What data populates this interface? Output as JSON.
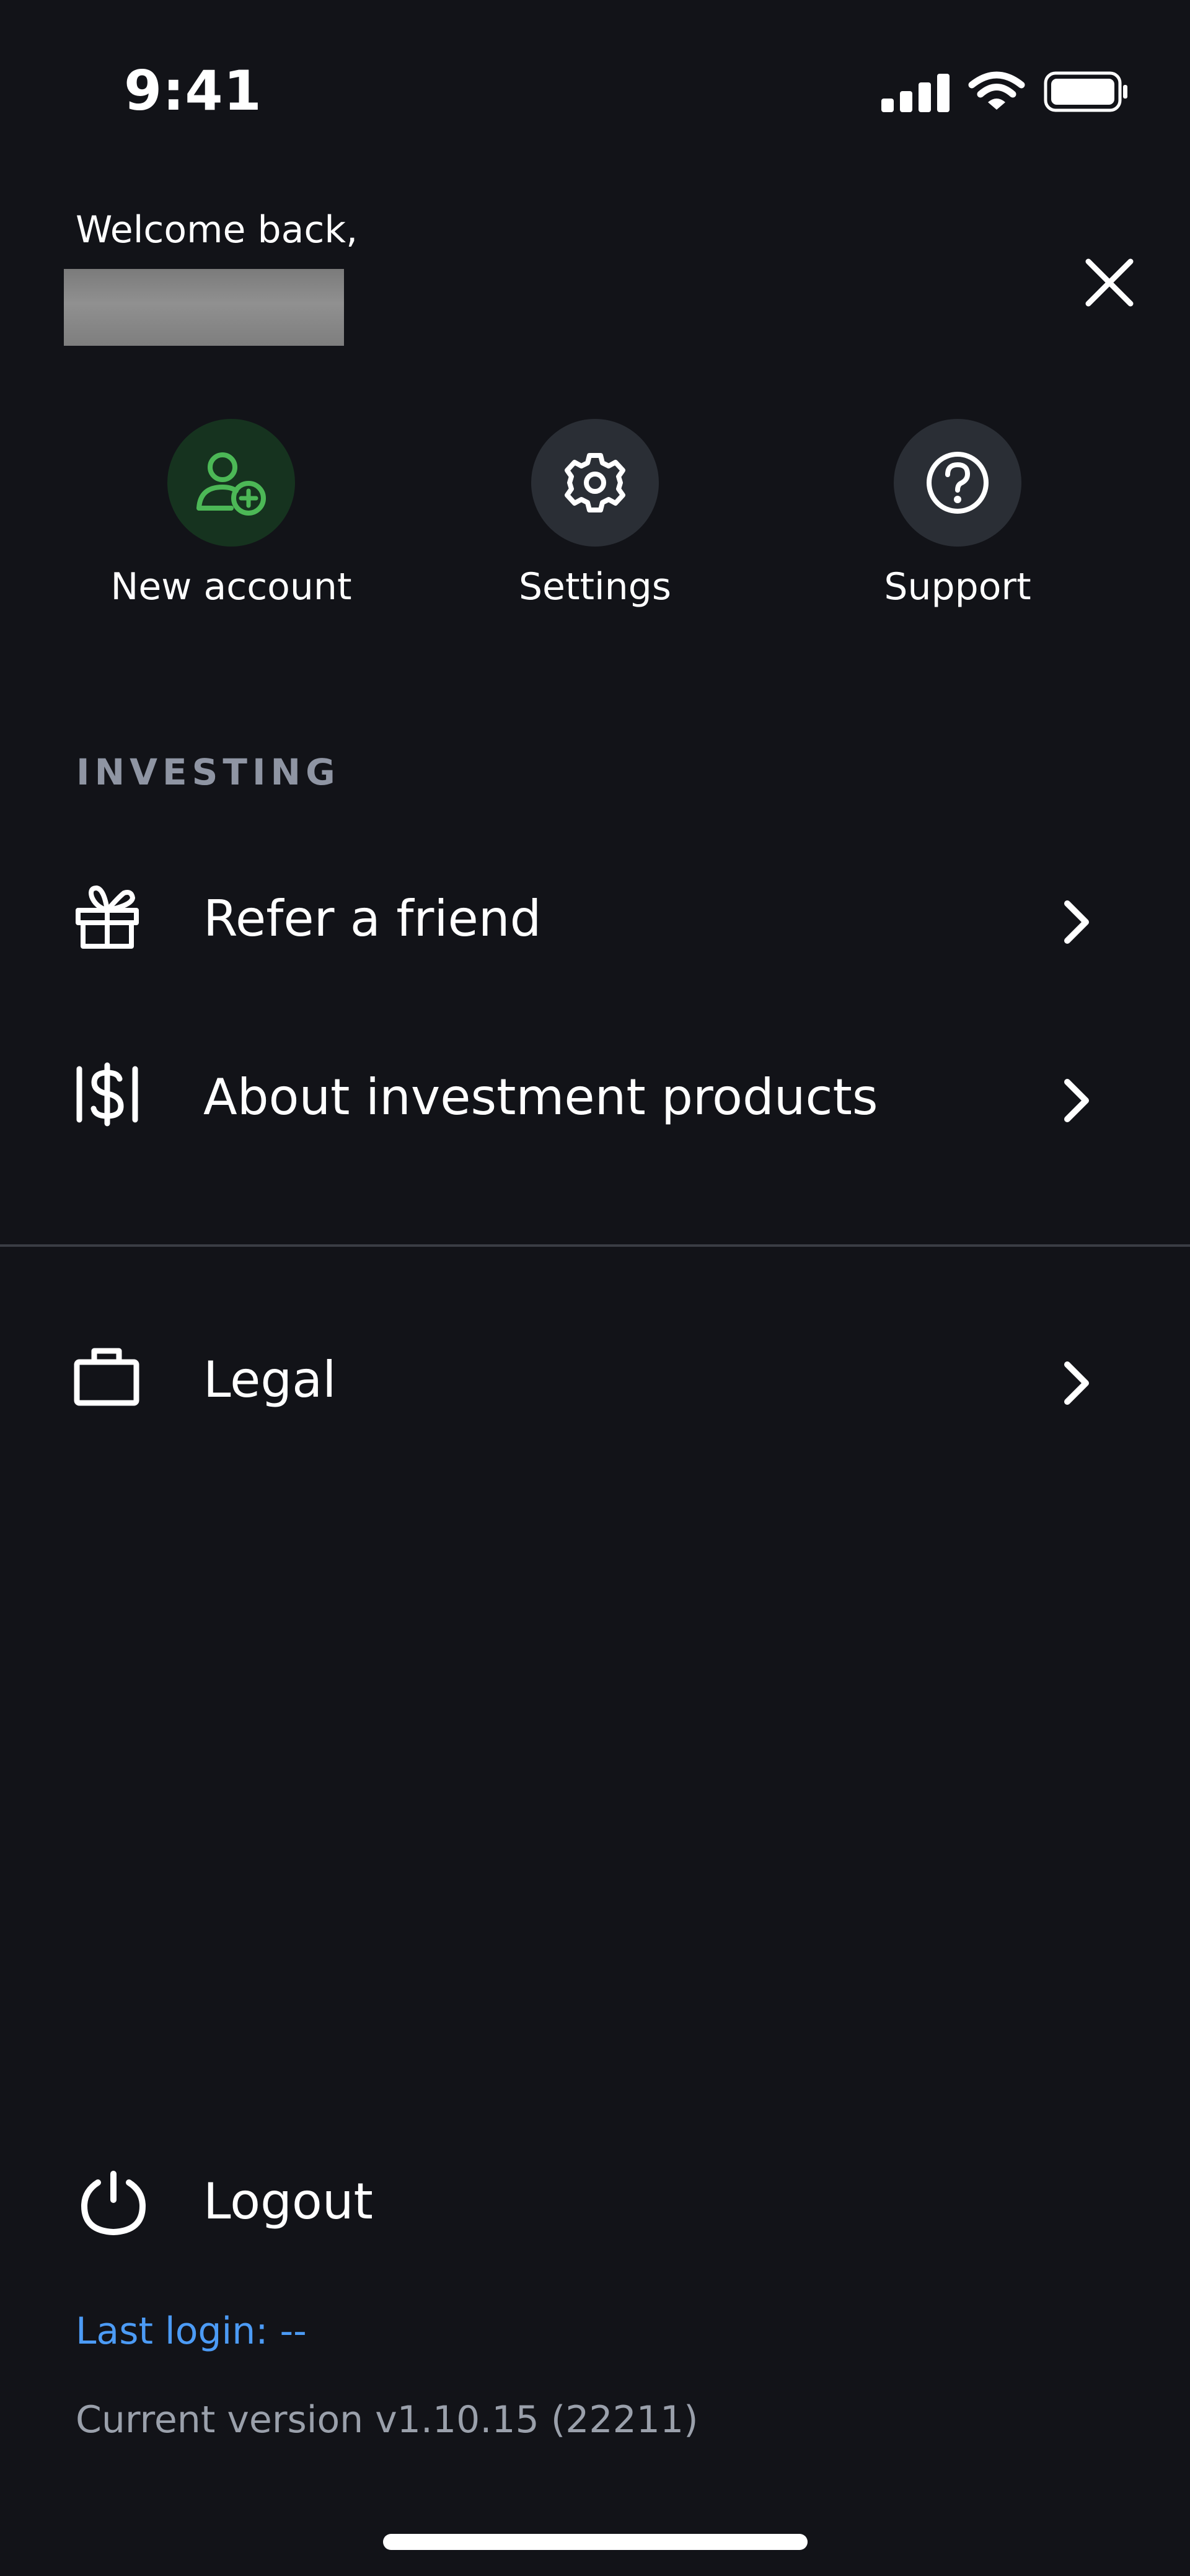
{
  "status_bar": {
    "time": "9:41",
    "icons": [
      "signal-icon",
      "wifi-icon",
      "battery-icon"
    ]
  },
  "header": {
    "welcome_text": "Welcome back,",
    "close_icon": "close-icon"
  },
  "quick_actions": [
    {
      "label": "New account",
      "icon": "add-user-icon",
      "color": "#4cb856"
    },
    {
      "label": "Settings",
      "icon": "gear-icon",
      "color": "#ffffff"
    },
    {
      "label": "Support",
      "icon": "help-icon",
      "color": "#ffffff"
    }
  ],
  "investing": {
    "section_title": "INVESTING",
    "items": [
      {
        "label": "Refer a friend",
        "icon": "gift-icon"
      },
      {
        "label": "About investment products",
        "icon": "dollar-icon"
      }
    ]
  },
  "other_items": [
    {
      "label": "Legal",
      "icon": "briefcase-icon"
    }
  ],
  "footer": {
    "logout_label": "Logout",
    "last_login": "Last login: --",
    "version": "Current version v1.10.15 (22211)"
  },
  "colors": {
    "background": "#121318",
    "accent_green": "#4cb856",
    "link_blue": "#4c9bf5",
    "muted_text": "#8f95a3"
  }
}
